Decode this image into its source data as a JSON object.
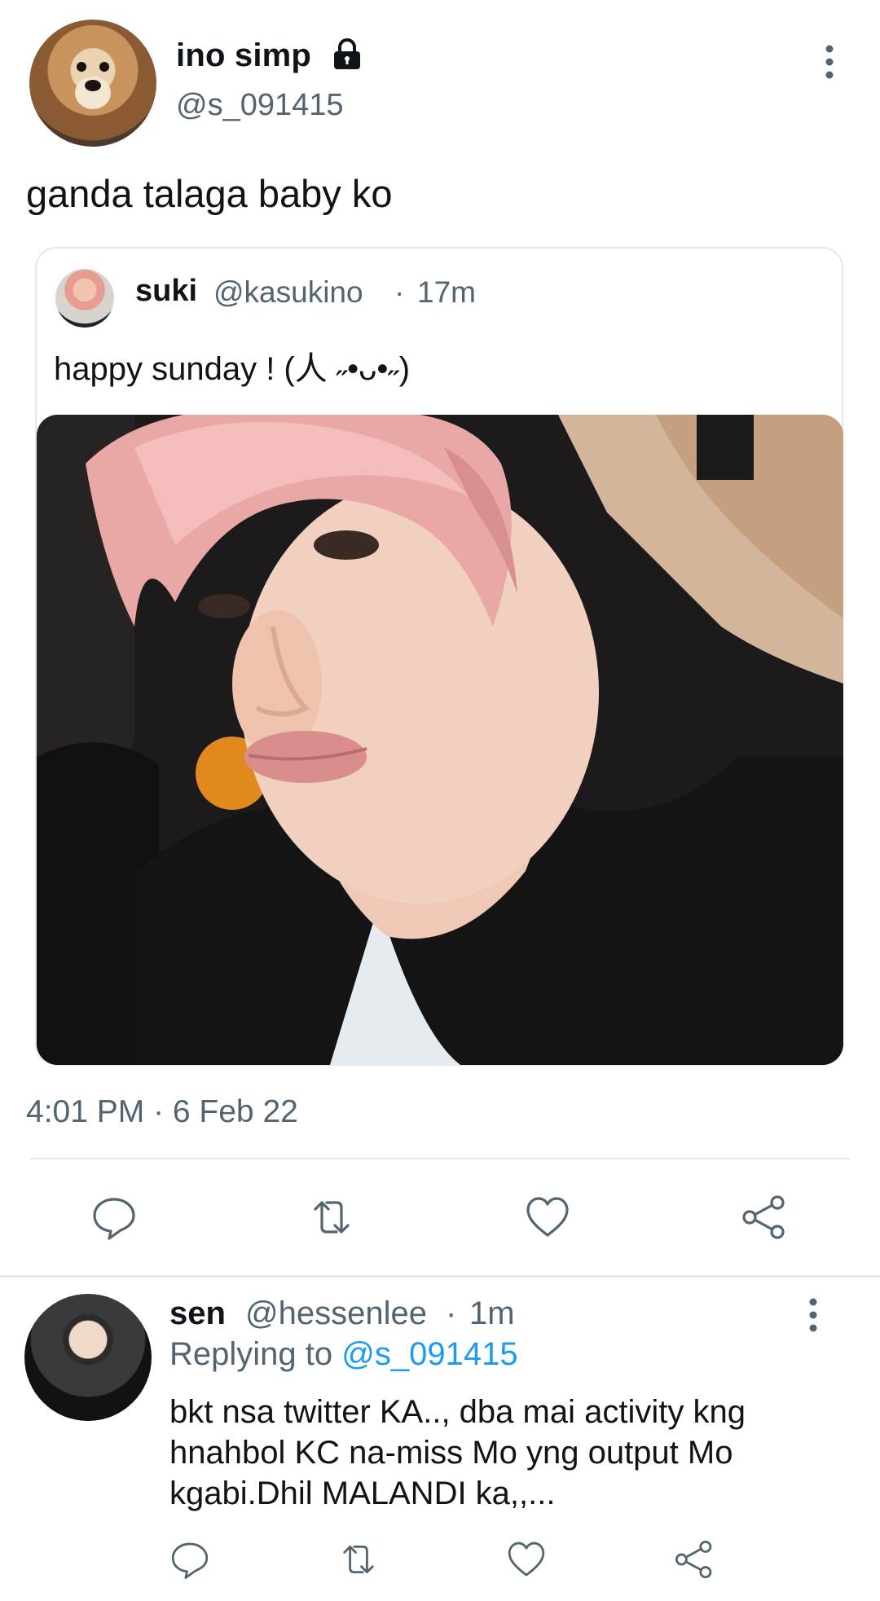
{
  "tweet": {
    "display_name": "ino simp",
    "handle": "@s_091415",
    "protected_icon": "lock-icon",
    "text": "ganda talaga baby ko",
    "timestamp": "4:01 PM · 6 Feb 22",
    "avatar": "dog-avatar"
  },
  "quoted_tweet": {
    "display_name": "suki",
    "handle": "@kasukino",
    "dot": "·",
    "time": "17m",
    "text": "happy sunday ! (人 ˶•ᴗ•˶)",
    "photo": "selfie-photo"
  },
  "reply": {
    "display_name": "sen",
    "handle": "@hessenlee",
    "dot": "·",
    "time": "1m",
    "replying_prefix": "Replying to ",
    "replying_to": "@s_091415",
    "text": "bkt nsa twitter KA.., dba mai activity kng hnahbol KC na-miss Mo yng output Mo kgabi.Dhil MALANDI ka,,..."
  },
  "actions": [
    "reply-icon",
    "retweet-icon",
    "like-icon",
    "share-icon"
  ],
  "colors": {
    "text": "#0f1419",
    "secondary": "#536471",
    "link": "#1d9bf0",
    "divider": "#e3e7ea"
  }
}
